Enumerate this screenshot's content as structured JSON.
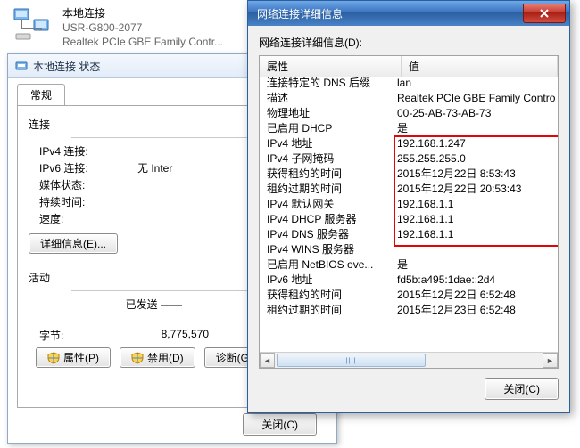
{
  "header": {
    "name": "本地连接",
    "device": "USR-G800-2077",
    "driver": "Realtek PCIe GBE Family Contr..."
  },
  "status": {
    "title": "本地连接 状态",
    "tab": "常规",
    "connection_group": "连接",
    "ipv4_label": "IPv4 连接:",
    "ipv4_value": "",
    "ipv6_label": "IPv6 连接:",
    "ipv6_value": "无 Inter",
    "media_label": "媒体状态:",
    "media_value": "",
    "duration_label": "持续时间:",
    "duration_value": "",
    "speed_label": "速度:",
    "speed_value": "",
    "details_btn": "详细信息(E)...",
    "activity_group": "活动",
    "sent_label": "已发送 ——",
    "bytes_label": "字节:",
    "bytes_value": "8,775,570",
    "props_btn": "属性(P)",
    "disable_btn": "禁用(D)",
    "diag_btn": "诊断(G)",
    "close_btn": "关闭(C)"
  },
  "detail": {
    "title": "网络连接详细信息",
    "subtitle": "网络连接详细信息(D):",
    "col_prop": "属性",
    "col_val": "值",
    "close_btn": "关闭(C)",
    "rows": [
      {
        "p": "连接特定的 DNS 后缀",
        "v": "lan"
      },
      {
        "p": "描述",
        "v": "Realtek PCIe GBE Family Contro"
      },
      {
        "p": "物理地址",
        "v": "00-25-AB-73-AB-73"
      },
      {
        "p": "已启用 DHCP",
        "v": "是"
      },
      {
        "p": "IPv4 地址",
        "v": "192.168.1.247"
      },
      {
        "p": "IPv4 子网掩码",
        "v": "255.255.255.0"
      },
      {
        "p": "获得租约的时间",
        "v": "2015年12月22日 8:53:43"
      },
      {
        "p": "租约过期的时间",
        "v": "2015年12月22日 20:53:43"
      },
      {
        "p": "IPv4 默认网关",
        "v": "192.168.1.1"
      },
      {
        "p": "IPv4 DHCP 服务器",
        "v": "192.168.1.1"
      },
      {
        "p": "IPv4 DNS 服务器",
        "v": "192.168.1.1"
      },
      {
        "p": "IPv4 WINS 服务器",
        "v": ""
      },
      {
        "p": "已启用 NetBIOS ove...",
        "v": "是"
      },
      {
        "p": "IPv6 地址",
        "v": "fd5b:a495:1dae::2d4"
      },
      {
        "p": "获得租约的时间",
        "v": "2015年12月22日 6:52:48"
      },
      {
        "p": "租约过期的时间",
        "v": "2015年12月23日 6:52:48"
      }
    ]
  }
}
